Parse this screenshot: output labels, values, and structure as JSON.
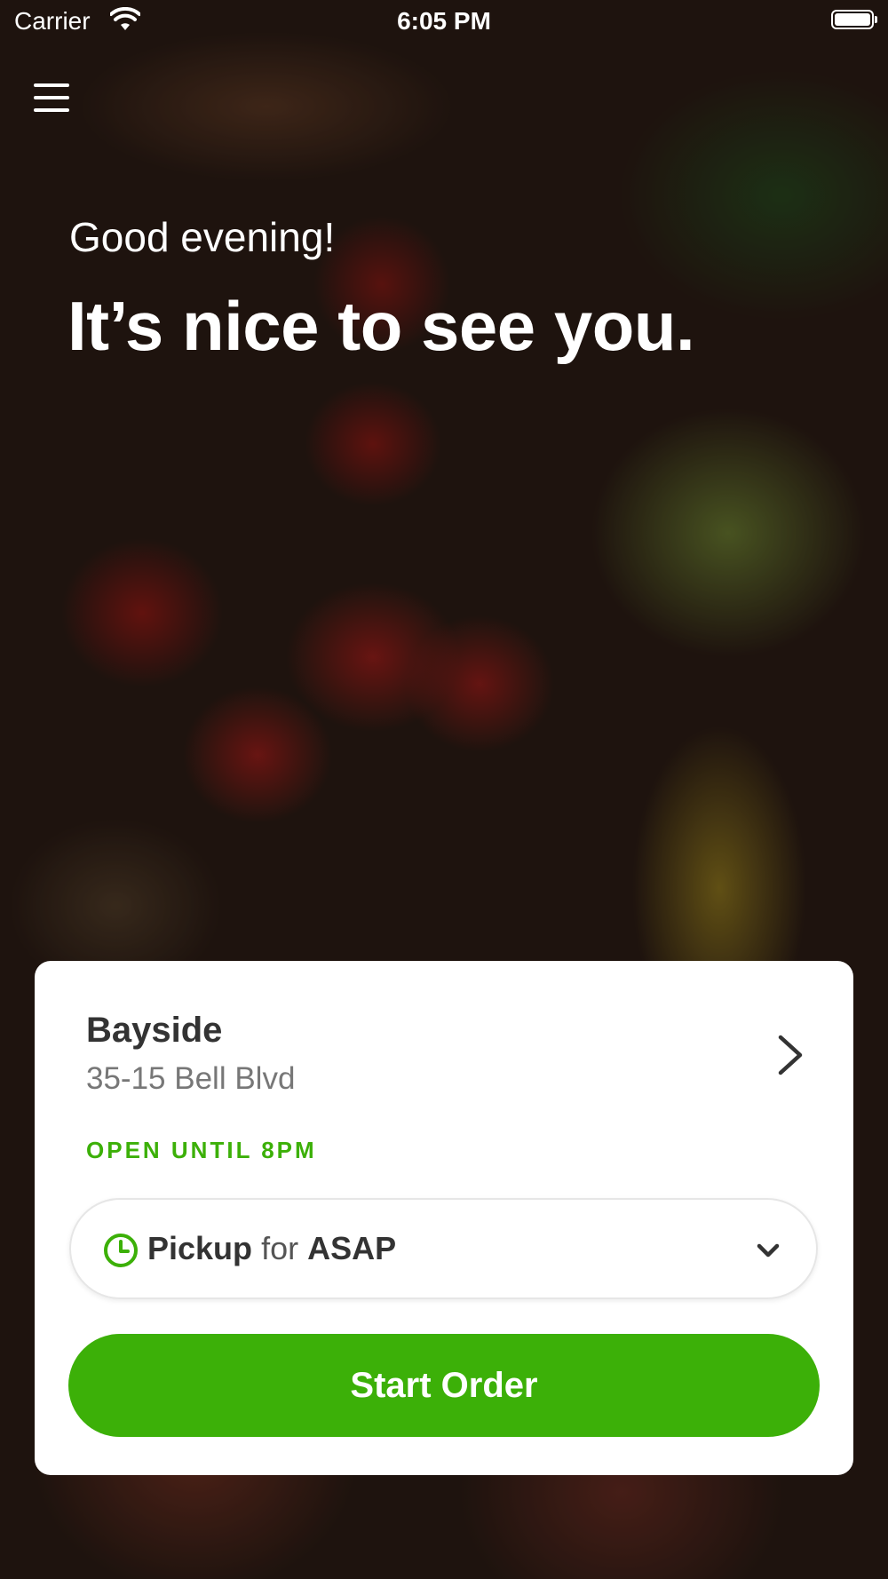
{
  "status_bar": {
    "carrier": "Carrier",
    "time": "6:05 PM"
  },
  "hero": {
    "greeting": "Good evening!",
    "headline": "It’s nice to see you."
  },
  "store": {
    "name": "Bayside",
    "address": "35-15 Bell Blvd",
    "hours": "OPEN UNTIL 8PM"
  },
  "order_mode": {
    "mode": "Pickup",
    "connector": "for",
    "when": "ASAP"
  },
  "actions": {
    "start_order": "Start Order"
  },
  "icons": {
    "menu": "hamburger-menu-icon",
    "store_chevron": "chevron-right-icon",
    "clock": "clock-icon",
    "dropdown": "chevron-down-icon",
    "wifi": "wifi-icon",
    "battery": "battery-icon"
  },
  "colors": {
    "accent": "#3cb008",
    "text_dark": "#333333",
    "text_muted": "#777777"
  }
}
